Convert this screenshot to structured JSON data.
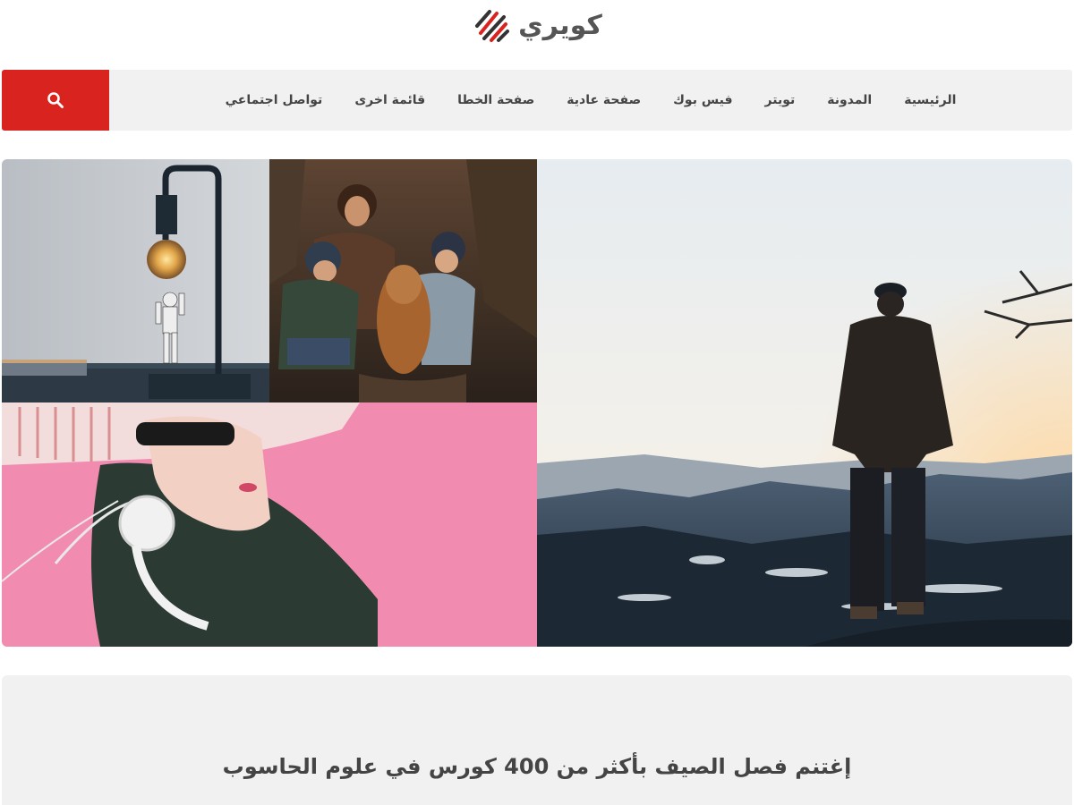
{
  "site": {
    "logo_text": "كويري"
  },
  "nav": {
    "items": [
      "الرئيسية",
      "المدونة",
      "تويتر",
      "فيس بوك",
      "صفحة عادية",
      "صفحة الخطا",
      "قائمة اخرى",
      "تواصل اجتماعي"
    ]
  },
  "search": {
    "icon": "search-icon"
  },
  "promo": {
    "title": "إغتنم فصل الصيف بأكثر من 400 كورس في علوم الحاسوب"
  },
  "colors": {
    "accent": "#d9231f",
    "nav_bg": "#f1f1f1",
    "text": "#444444"
  },
  "mosaic": {
    "tiles": [
      "lamp-photo",
      "family-dog-photo",
      "headphones-girl-photo",
      "mountain-man-photo"
    ]
  }
}
